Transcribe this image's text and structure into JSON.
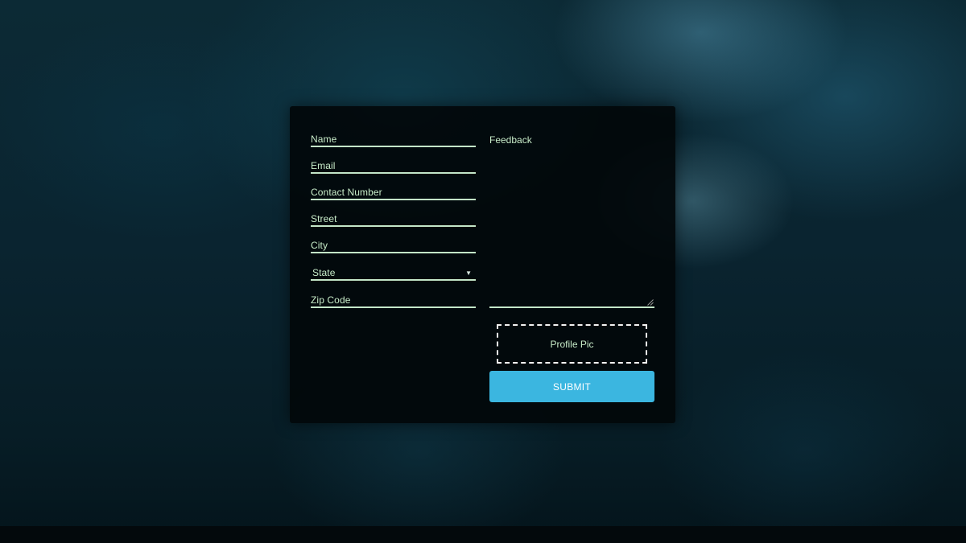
{
  "form": {
    "fields": {
      "name": "Name",
      "email": "Email",
      "contact_number": "Contact Number",
      "street": "Street",
      "city": "City",
      "state": "State",
      "zip_code": "Zip Code"
    },
    "state_dropdown_icon": "triangle-down-icon",
    "feedback_label": "Feedback",
    "profile_pic_label": "Profile Pic",
    "submit_label": "SUBMIT"
  },
  "colors": {
    "accent": "#3bb6e0",
    "label_text": "#c8ecc9",
    "underline": "#c3e6c8",
    "card_background": "#02080a"
  }
}
